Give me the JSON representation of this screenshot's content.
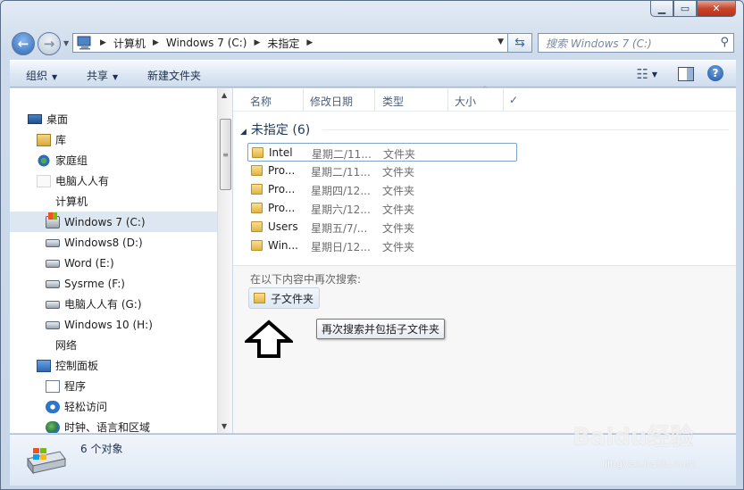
{
  "window": {
    "caption_buttons": [
      "minimize",
      "maximize",
      "close"
    ]
  },
  "address": {
    "crumbs": [
      "计算机",
      "Windows 7  (C:)",
      "未指定"
    ],
    "search_placeholder": "搜索 Windows 7  (C:)"
  },
  "toolbar": {
    "organize": "组织",
    "share": "共享",
    "new_folder": "新建文件夹"
  },
  "nav": {
    "items": [
      {
        "label": "桌面",
        "icon": "desktop-icon"
      },
      {
        "label": "库",
        "icon": "library-icon"
      },
      {
        "label": "家庭组",
        "icon": "homegroup-icon"
      },
      {
        "label": "电脑人人有",
        "icon": "user-folder-icon"
      },
      {
        "label": "计算机",
        "icon": "computer-icon"
      },
      {
        "label": "Windows 7  (C:)",
        "icon": "system-drive-icon",
        "selected": true
      },
      {
        "label": "Windows8 (D:)",
        "icon": "drive-icon"
      },
      {
        "label": "Word (E:)",
        "icon": "drive-icon"
      },
      {
        "label": "Sysrme (F:)",
        "icon": "drive-icon"
      },
      {
        "label": "电脑人人有 (G:)",
        "icon": "drive-icon"
      },
      {
        "label": "Windows 10 (H:)",
        "icon": "drive-icon"
      },
      {
        "label": "网络",
        "icon": "network-icon"
      },
      {
        "label": "控制面板",
        "icon": "control-panel-icon"
      },
      {
        "label": "程序",
        "icon": "programs-icon"
      },
      {
        "label": "轻松访问",
        "icon": "ease-of-access-icon"
      },
      {
        "label": "时钟、语言和区域",
        "icon": "clock-language-icon"
      }
    ]
  },
  "columns": {
    "name": "名称",
    "date": "修改日期",
    "type": "类型",
    "size": "大小"
  },
  "group": {
    "title": "未指定 (6)"
  },
  "files": [
    {
      "name": "Intel",
      "date": "星期二/11...",
      "type": "文件夹"
    },
    {
      "name": "Pro...",
      "date": "星期二/11...",
      "type": "文件夹"
    },
    {
      "name": "Pro...",
      "date": "星期四/12...",
      "type": "文件夹"
    },
    {
      "name": "Pro...",
      "date": "星期六/12...",
      "type": "文件夹"
    },
    {
      "name": "Users",
      "date": "星期五/7/...",
      "type": "文件夹"
    },
    {
      "name": "Win...",
      "date": "星期日/12...",
      "type": "文件夹"
    }
  ],
  "search_again": {
    "label": "在以下内容中再次搜索:",
    "subfolder_button": "子文件夹",
    "tooltip": "再次搜索并包括子文件夹"
  },
  "details": {
    "count": "6 个对象"
  },
  "watermark": {
    "brand": "Baidu经验",
    "url": "jingyan.baidu.com"
  }
}
